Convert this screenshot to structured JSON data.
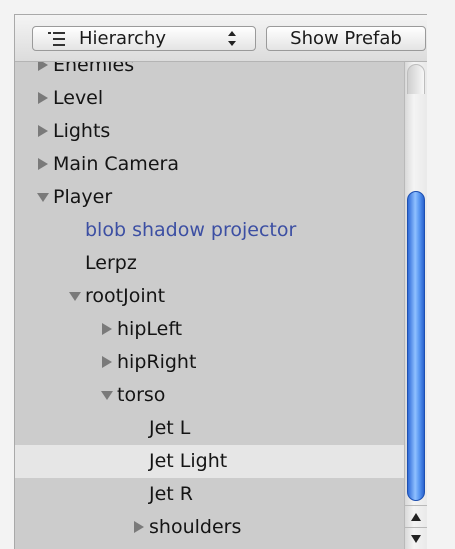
{
  "toolbar": {
    "view_popup_label": "Hierarchy",
    "view_popup_icon": "list-icon",
    "show_prefab_label": "Show Prefab"
  },
  "tree": {
    "rows": [
      {
        "label": "Enemies",
        "depth": 0,
        "arrow": "collapsed",
        "partial": true
      },
      {
        "label": "Level",
        "depth": 0,
        "arrow": "collapsed"
      },
      {
        "label": "Lights",
        "depth": 0,
        "arrow": "collapsed"
      },
      {
        "label": "Main Camera",
        "depth": 0,
        "arrow": "collapsed"
      },
      {
        "label": "Player",
        "depth": 0,
        "arrow": "expanded"
      },
      {
        "label": "blob shadow projector",
        "depth": 1,
        "arrow": "none",
        "style": "prefab-blue"
      },
      {
        "label": "Lerpz",
        "depth": 1,
        "arrow": "none"
      },
      {
        "label": "rootJoint",
        "depth": 1,
        "arrow": "expanded"
      },
      {
        "label": "hipLeft",
        "depth": 2,
        "arrow": "collapsed"
      },
      {
        "label": "hipRight",
        "depth": 2,
        "arrow": "collapsed"
      },
      {
        "label": "torso",
        "depth": 2,
        "arrow": "expanded"
      },
      {
        "label": "Jet L",
        "depth": 3,
        "arrow": "none"
      },
      {
        "label": "Jet Light",
        "depth": 3,
        "arrow": "none",
        "selected": true
      },
      {
        "label": "Jet R",
        "depth": 3,
        "arrow": "none"
      },
      {
        "label": "shoulders",
        "depth": 3,
        "arrow": "collapsed"
      }
    ],
    "selected_label": "Jet Light"
  },
  "scrollbar": {
    "thumb_color": "#3b7ae6",
    "up_icon": "arrow-up-icon",
    "down_icon": "arrow-down-icon"
  },
  "colors": {
    "tree_background": "#cccccc",
    "selected_row": "#e6e6e6",
    "prefab_text": "#3c4fa3"
  }
}
